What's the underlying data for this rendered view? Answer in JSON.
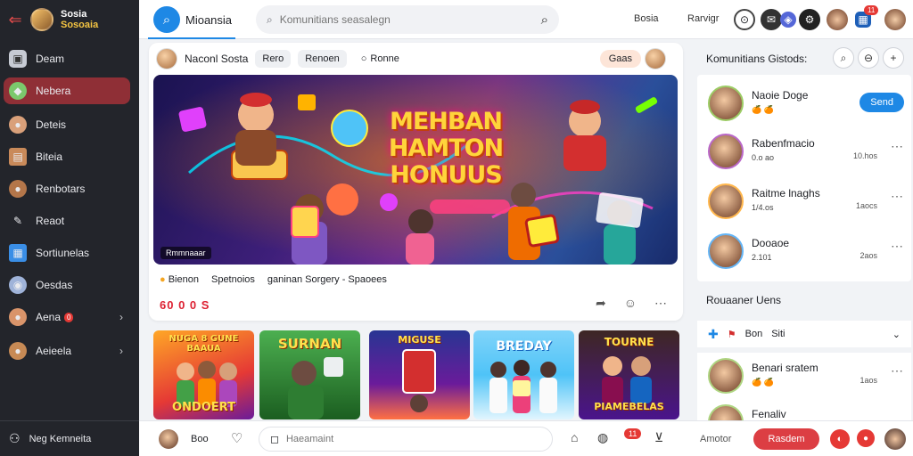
{
  "sidebar": {
    "brand_line1": "Sosia",
    "brand_line2": "Sosoaia",
    "items": [
      {
        "label": "Deam",
        "icon": "dashboard-icon"
      },
      {
        "label": "Nebera",
        "icon": "gamepad-icon",
        "active": true
      },
      {
        "label": "Deteis",
        "icon": "user-icon"
      },
      {
        "label": "Biteia",
        "icon": "card-icon"
      },
      {
        "label": "Renbotars",
        "icon": "user-icon"
      },
      {
        "label": "Reaot",
        "icon": "pencil-icon"
      },
      {
        "label": "Sortiunelas",
        "icon": "chart-icon"
      },
      {
        "label": "Oesdas",
        "icon": "globe-icon"
      },
      {
        "label": "Aena",
        "icon": "user-icon",
        "badge": "0"
      },
      {
        "label": "Aeieela",
        "icon": "user-icon"
      }
    ],
    "footer_label": "Neg Kemneita"
  },
  "topbar": {
    "app_title": "Mioansia",
    "search_placeholder": "Komunitians seasalegn",
    "link1": "Bosia",
    "link2": "Rarvigr"
  },
  "post": {
    "author": "Naconl Sosta",
    "tag1": "Rero",
    "tag2": "Renoen",
    "status": "Ronne",
    "pill": "Gaas",
    "banner_title_lines": [
      "MEHBAN",
      "HAMTON",
      "HONUUS"
    ],
    "banner_caption": "Rmmnaaar",
    "meta1": "Bienon",
    "meta2": "Spetnoios",
    "meta3": "ganinan Sorgery - Spaoees",
    "stats": "60 0 0 S"
  },
  "thumbnails": [
    {
      "label_top": "NUGA 8 GUNE BAAUA",
      "label_bottom": "ONDOERT"
    },
    {
      "label_top": "SURNAN",
      "label_bottom": ""
    },
    {
      "label_top": "MIGUSE",
      "label_bottom": ""
    },
    {
      "label_top": "BREDAY",
      "label_bottom": ""
    },
    {
      "label_top": "TOURNE",
      "label_bottom": "PIAMEBELAS"
    }
  ],
  "right_panel": {
    "title": "Komunitians Gistods:",
    "friends": [
      {
        "name": "Naoie Doge",
        "sub": "",
        "meta": "",
        "action": "Send"
      },
      {
        "name": "Rabenfmacio",
        "sub": "0.o ao",
        "meta": "10.hos",
        "action": ""
      },
      {
        "name": "Raitme lnaghs",
        "sub": "1/4.os",
        "meta": "1aocs",
        "action": ""
      },
      {
        "name": "Dooaoe",
        "sub": "2.101",
        "meta": "2aos",
        "action": ""
      }
    ],
    "section_title": "Rouaaner Uens",
    "filter_label": "Bon",
    "filter_value": "Siti",
    "friends2": [
      {
        "name": "Benari sratem",
        "meta": "1aos"
      },
      {
        "name": "Fenaliv",
        "meta": ""
      }
    ]
  },
  "bottombar": {
    "name": "Boo",
    "input_placeholder": "Haeamaint",
    "badge": "11",
    "label": "Amotor",
    "cta": "Rasdem"
  },
  "colors": {
    "accent": "#1e88e5",
    "active": "#8f2f36",
    "cta": "#dc3e43",
    "sidebar": "#23252b"
  }
}
